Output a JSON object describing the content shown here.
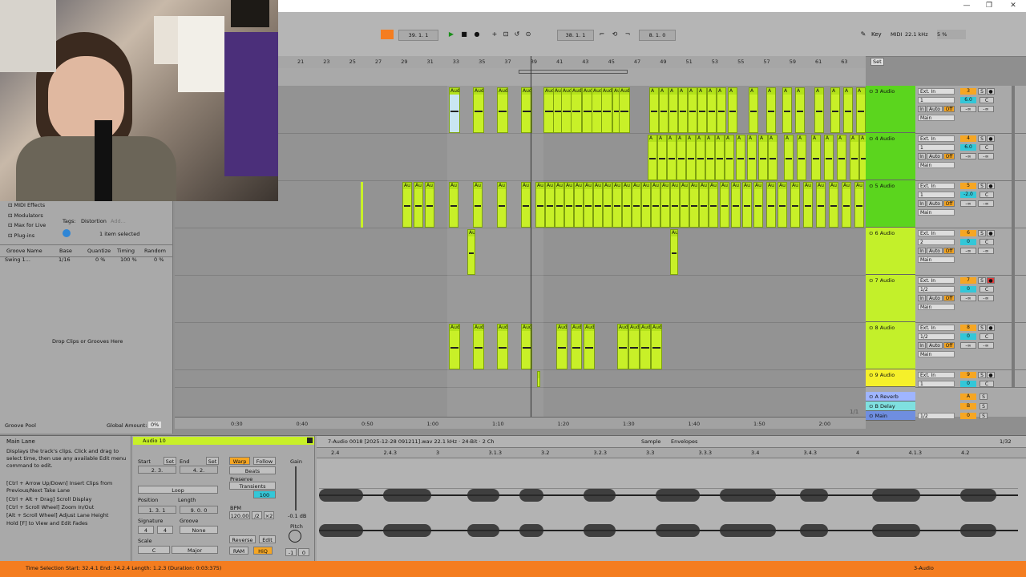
{
  "window": {
    "minimize": "—",
    "maximize": "❐",
    "close": "✕"
  },
  "transport": {
    "tempo_bar": "39.",
    "tempo_beat": "1.",
    "tempo_sixteenth": "1",
    "loop_start": "38.",
    "loop_start_beat": "1.",
    "loop_start_six": "1",
    "loop_len": "8.",
    "loop_len_beat": "1.",
    "loop_len_six": "0",
    "key_label": "Key",
    "midi_label": "MIDI",
    "sample_rate": "22.1 kHz",
    "cpu": "5 %"
  },
  "ruler_numbers": [
    "21",
    "23",
    "25",
    "27",
    "29",
    "31",
    "33",
    "35",
    "37",
    "39",
    "41",
    "43",
    "45",
    "47",
    "49",
    "51",
    "53",
    "55",
    "57",
    "59",
    "61",
    "63"
  ],
  "ruler_set": "Set",
  "time_ruler": [
    "0:30",
    "0:40",
    "0:50",
    "1:00",
    "1:10",
    "1:20",
    "1:30",
    "1:40",
    "1:50",
    "2:00"
  ],
  "tracks": [
    {
      "name": "3 Audio",
      "num": "3",
      "vol": "6.0",
      "route": "1",
      "color": "#5bd51e",
      "io": "Ext. In",
      "out": "Main"
    },
    {
      "name": "4 Audio",
      "num": "4",
      "vol": "6.0",
      "route": "1",
      "color": "#5bd51e",
      "io": "Ext. In",
      "out": "Main"
    },
    {
      "name": "5 Audio",
      "num": "5",
      "vol": "-2.0",
      "route": "1",
      "color": "#5bd51e",
      "io": "Ext. In",
      "out": "Main"
    },
    {
      "name": "6 Audio",
      "num": "6",
      "vol": "0",
      "route": "2",
      "color": "#c3f02a",
      "io": "Ext. In",
      "out": "Main"
    },
    {
      "name": "7 Audio",
      "num": "7",
      "vol": "0",
      "route": "1/2",
      "color": "#c3f02a",
      "io": "Ext. In",
      "out": "Main"
    },
    {
      "name": "8 Audio",
      "num": "8",
      "vol": "0",
      "route": "1/2",
      "color": "#c3f02a",
      "io": "Ext. In",
      "out": "Main"
    },
    {
      "name": "9 Audio",
      "num": "9",
      "vol": "0",
      "route": "1",
      "color": "#f5f02a",
      "io": "Ext. In",
      "out": ""
    }
  ],
  "returns": [
    {
      "name": "A Reverb",
      "letter": "A",
      "color": "#9fb5ff"
    },
    {
      "name": "B Delay",
      "letter": "B",
      "color": "#7fe0e0"
    },
    {
      "name": "Main",
      "letter": "0",
      "color": "#6f8ee0"
    }
  ],
  "track_labels": {
    "in": "In",
    "auto": "Auto",
    "off": "Off",
    "s": "S",
    "c": "C",
    "inf": "-∞",
    "main_route": "1/2"
  },
  "browser": {
    "items": [
      "MIDI Effects",
      "Modulators",
      "Max for Live",
      "Plug-ins"
    ],
    "tags_label": "Tags:",
    "tag": "Distortion",
    "add": "Add...",
    "selected": "1 item selected",
    "groove_cols": [
      "Groove Name",
      "Base",
      "Quantize",
      "Timing",
      "Random"
    ],
    "groove_row": {
      "name": "Swing 1...",
      "base": "1/16",
      "quantize": "0 %",
      "timing": "100 %",
      "random": "0 %"
    },
    "drop_text": "Drop Clips or Grooves Here",
    "pool": "Groove Pool",
    "global_amount": "Global Amount:",
    "global_val": "0%"
  },
  "info": {
    "title": "Main Lane",
    "text1": "Displays the track's clips. Click and drag to select time, then use any available Edit menu command to edit.",
    "text2": "[Ctrl + Arrow Up/Down] Insert Clips from Previous/Next Take Lane",
    "text3": "[Ctrl + Alt + Drag] Scroll Display",
    "text4": "[Ctrl + Scroll Wheel] Zoom In/Out",
    "text5": "[Alt + Scroll Wheel] Adjust Lane Height",
    "text6": "Hold [F] to View and Edit Fades"
  },
  "clip_panel": {
    "name": "Audio 10",
    "start": "Start",
    "end": "End",
    "set": "Set",
    "start_val": "2. 3.",
    "end_val": "4. 2.",
    "loop": "Loop",
    "position": "Position",
    "length": "Length",
    "pos_val": "1. 3. 1",
    "len_val": "9. 0. 0",
    "signature": "Signature",
    "sig_num": "4",
    "sig_den": "4",
    "groove": "Groove",
    "groove_val": "None",
    "scale": "Scale",
    "scale_root": "C",
    "scale_mode": "Major",
    "warp": "Warp",
    "follow": "Follow",
    "beats": "Beats",
    "preserve": "Preserve",
    "transients": "Transients",
    "hundred": "100",
    "bpm": "BPM",
    "bpm_val": "120.00",
    "half": "/2",
    "dbl": "×2",
    "gain": "Gain",
    "gain_val": "-0.1 dB",
    "pitch": "Pitch",
    "pitch_val": "-1",
    "pitch_cents": "0",
    "reverse": "Reverse",
    "edit": "Edit",
    "ram": "RAM",
    "hiq": "HiQ"
  },
  "sample_view": {
    "file": "7-Audio 0018 [2025-12-28 091211].wav  22.1 kHz · 24-Bit · 2 Ch",
    "tab_sample": "Sample",
    "tab_env": "Envelopes",
    "zoom": "1/32",
    "ticks": [
      "2.4",
      "2.4.3",
      "3",
      "3.1.3",
      "3.2",
      "3.2.3",
      "3.3",
      "3.3.3",
      "3.4",
      "3.4.3",
      "4",
      "4.1.3",
      "4.2"
    ]
  },
  "status": {
    "text": "Time Selection   Start: 32.4.1   End: 34.2.4   Length: 1.2.3   (Duration: 0:03:375)",
    "track": "3-Audio"
  },
  "arr_footer": "1/1"
}
